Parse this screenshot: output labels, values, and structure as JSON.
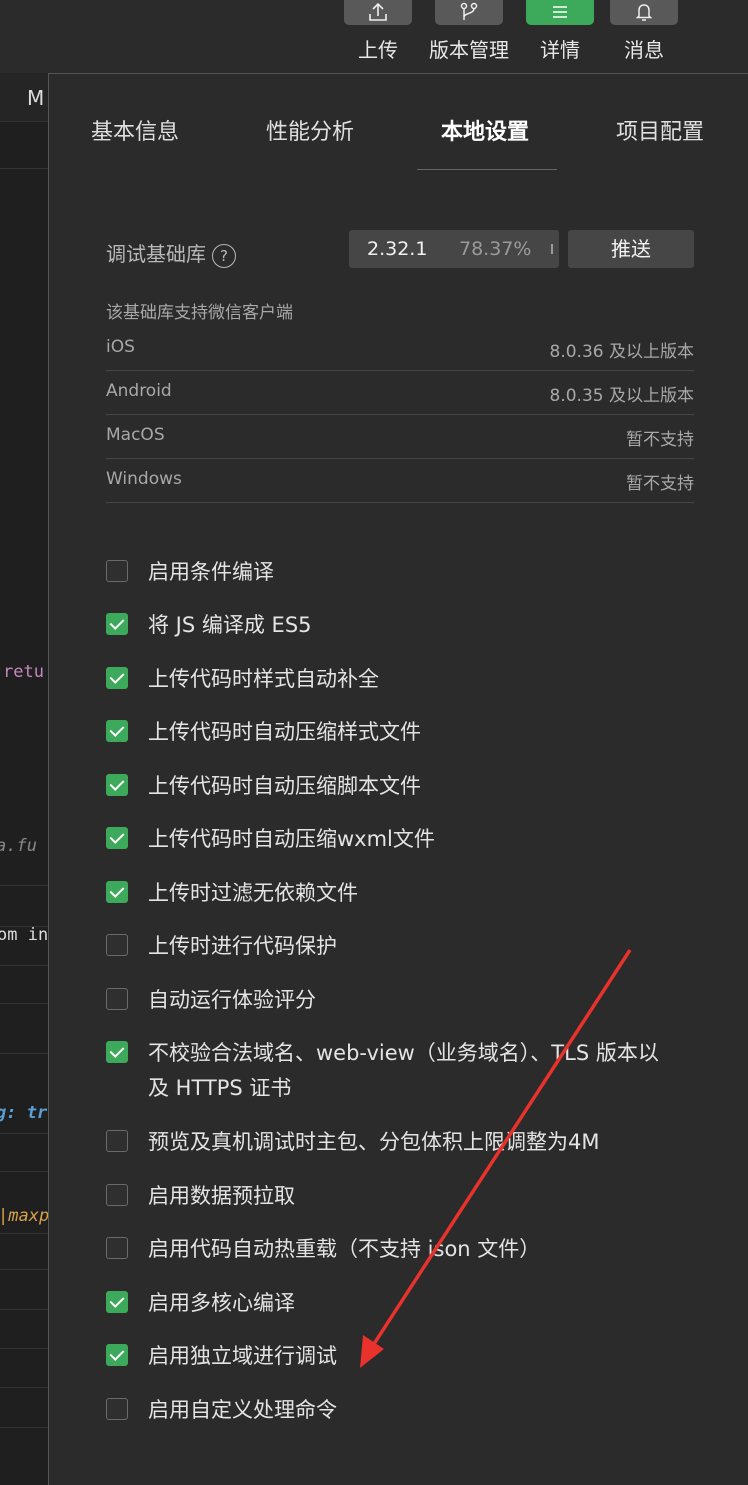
{
  "toolbar": {
    "items": [
      {
        "label": "上传",
        "icon": "upload-icon"
      },
      {
        "label": "版本管理",
        "icon": "branch-icon"
      },
      {
        "label": "详情",
        "icon": "menu-icon"
      },
      {
        "label": "消息",
        "icon": "bell-icon"
      }
    ]
  },
  "editor": {
    "tab_fragment": "M",
    "code": [
      "retu",
      "a.fu",
      "om in",
      "g: tr",
      "|maxp"
    ]
  },
  "tabs": [
    "基本信息",
    "性能分析",
    "本地设置",
    "项目配置"
  ],
  "active_tab": "本地设置",
  "debug_lib": {
    "label": "调试基础库",
    "help": "?",
    "version": "2.32.1",
    "percent": "78.37%",
    "push_label": "推送"
  },
  "support": {
    "title": "该基础库支持微信客户端",
    "rows": [
      {
        "name": "iOS",
        "value": "8.0.36 及以上版本"
      },
      {
        "name": "Android",
        "value": "8.0.35 及以上版本"
      },
      {
        "name": "MacOS",
        "value": "暂不支持"
      },
      {
        "name": "Windows",
        "value": "暂不支持"
      }
    ]
  },
  "options": [
    {
      "label": "启用条件编译",
      "checked": false
    },
    {
      "label": "将 JS 编译成 ES5",
      "checked": true
    },
    {
      "label": "上传代码时样式自动补全",
      "checked": true
    },
    {
      "label": "上传代码时自动压缩样式文件",
      "checked": true
    },
    {
      "label": "上传代码时自动压缩脚本文件",
      "checked": true
    },
    {
      "label": "上传代码时自动压缩wxml文件",
      "checked": true
    },
    {
      "label": "上传时过滤无依赖文件",
      "checked": true
    },
    {
      "label": "上传时进行代码保护",
      "checked": false
    },
    {
      "label": "自动运行体验评分",
      "checked": false
    },
    {
      "label": "不校验合法域名、web-view（业务域名）、TLS 版本以及 HTTPS 证书",
      "checked": true
    },
    {
      "label": "预览及真机调试时主包、分包体积上限调整为4M",
      "checked": false
    },
    {
      "label": "启用数据预拉取",
      "checked": false
    },
    {
      "label": "启用代码自动热重载（不支持 json 文件）",
      "checked": false
    },
    {
      "label": "启用多核心编译",
      "checked": true
    },
    {
      "label": "启用独立域进行调试",
      "checked": true
    },
    {
      "label": "启用自定义处理命令",
      "checked": false
    }
  ],
  "colors": {
    "accent": "#3caa5a",
    "arrow": "#e8322b"
  }
}
